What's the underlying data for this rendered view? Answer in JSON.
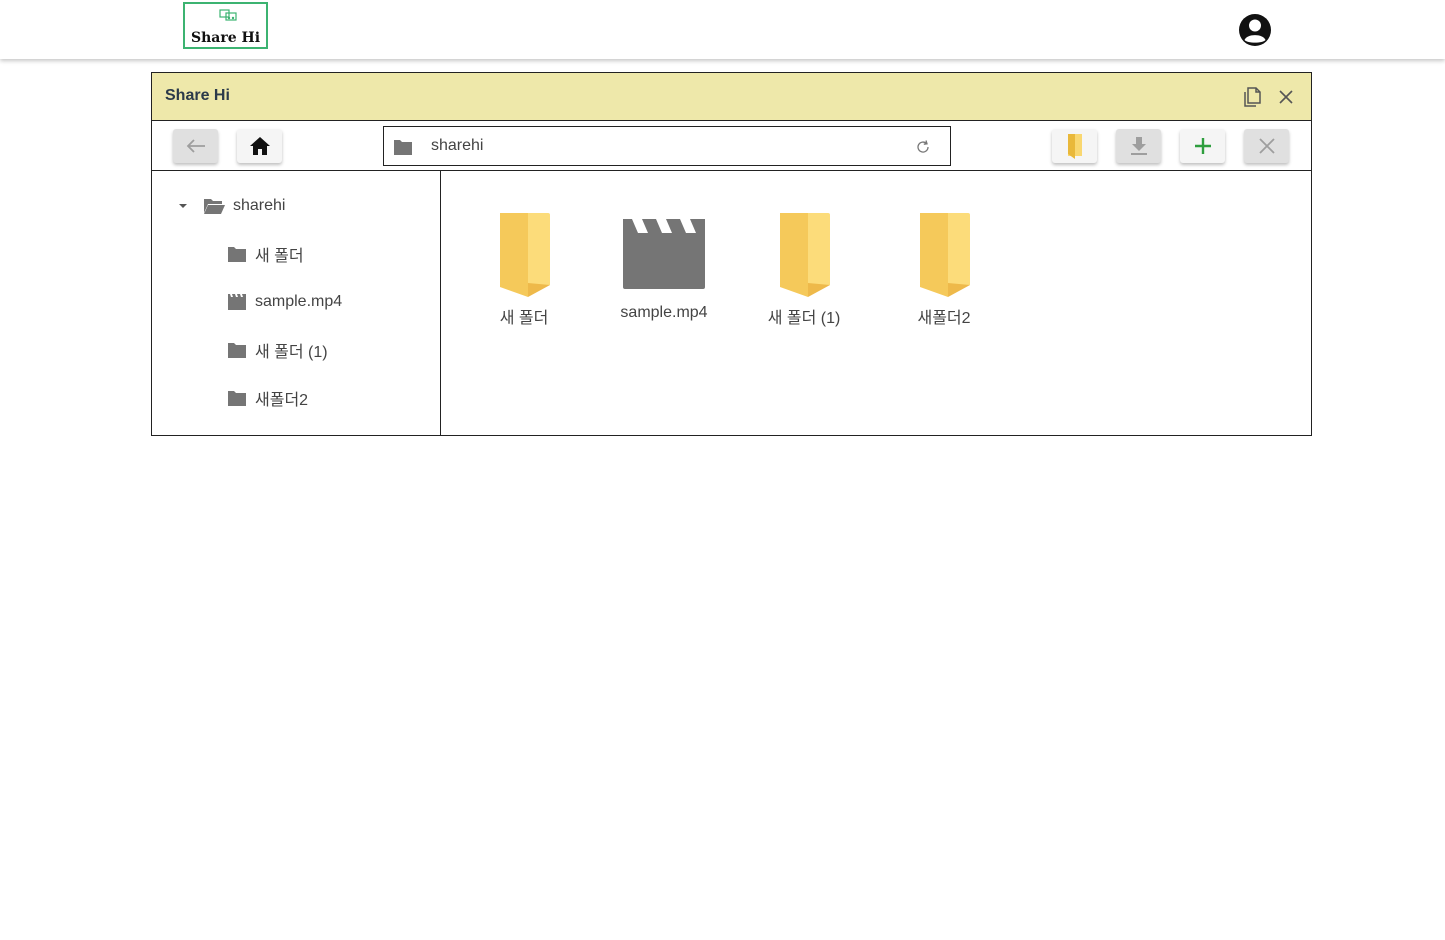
{
  "header": {
    "logo_text": "Share Hi",
    "avatar_icon": "account-circle-icon"
  },
  "window": {
    "title": "Share Hi",
    "actions": [
      {
        "name": "copy-icon"
      },
      {
        "name": "close-icon"
      }
    ]
  },
  "toolbar": {
    "back_icon": "arrow-left-icon",
    "home_icon": "home-icon",
    "path_icon": "folder-icon",
    "path": "sharehi",
    "refresh_icon": "refresh-icon",
    "buttons": [
      {
        "name": "new-folder-button",
        "icon": "folder-icon",
        "state": "enabled"
      },
      {
        "name": "download-button",
        "icon": "download-icon",
        "state": "disabled"
      },
      {
        "name": "add-button",
        "icon": "plus-icon",
        "state": "enabled"
      },
      {
        "name": "delete-button",
        "icon": "close-icon",
        "state": "disabled"
      }
    ]
  },
  "tree": {
    "root": {
      "label": "sharehi",
      "icon": "folder-open-icon",
      "expanded": true
    },
    "children": [
      {
        "label": "새 폴더",
        "icon": "folder-icon"
      },
      {
        "label": "sample.mp4",
        "icon": "movie-icon"
      },
      {
        "label": "새 폴더 (1)",
        "icon": "folder-icon"
      },
      {
        "label": "새폴더2",
        "icon": "folder-icon"
      }
    ]
  },
  "files": [
    {
      "label": "새 폴더",
      "type": "folder"
    },
    {
      "label": "sample.mp4",
      "type": "video"
    },
    {
      "label": "새 폴더 (1)",
      "type": "folder"
    },
    {
      "label": "새폴더2",
      "type": "folder"
    }
  ],
  "colors": {
    "title_bar": "#eee8aa",
    "logo_border": "#3cb371",
    "add_icon": "#2e9e3e",
    "folder_yellow": "#f7d36b",
    "icon_gray": "#757575"
  }
}
